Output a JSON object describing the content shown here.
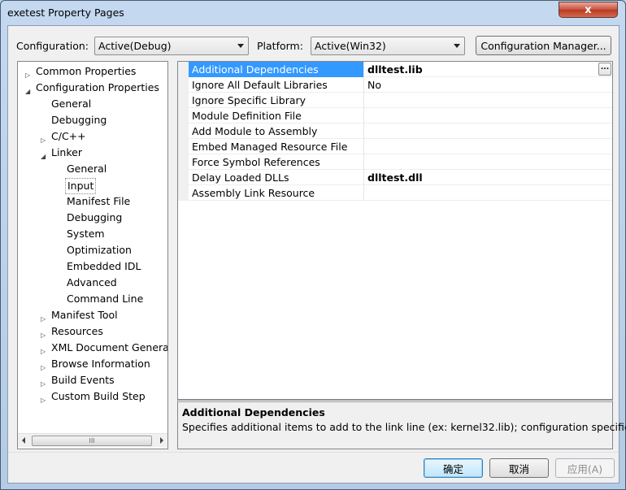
{
  "window": {
    "title": "exetest Property Pages",
    "close_glyph": "x"
  },
  "top_bar": {
    "configuration_label": "Configuration:",
    "configuration_value": "Active(Debug)",
    "platform_label": "Platform:",
    "platform_value": "Active(Win32)",
    "config_manager_label": "Configuration Manager..."
  },
  "tree": {
    "items": [
      {
        "label": "Common Properties",
        "expander": "▷"
      },
      {
        "label": "Configuration Properties",
        "expander": "◢"
      },
      {
        "label": "General",
        "expander": ""
      },
      {
        "label": "Debugging",
        "expander": ""
      },
      {
        "label": "C/C++",
        "expander": "▷"
      },
      {
        "label": "Linker",
        "expander": "◢"
      },
      {
        "label": "General",
        "expander": ""
      },
      {
        "label": "Input",
        "expander": ""
      },
      {
        "label": "Manifest File",
        "expander": ""
      },
      {
        "label": "Debugging",
        "expander": ""
      },
      {
        "label": "System",
        "expander": ""
      },
      {
        "label": "Optimization",
        "expander": ""
      },
      {
        "label": "Embedded IDL",
        "expander": ""
      },
      {
        "label": "Advanced",
        "expander": ""
      },
      {
        "label": "Command Line",
        "expander": ""
      },
      {
        "label": "Manifest Tool",
        "expander": "▷"
      },
      {
        "label": "Resources",
        "expander": "▷"
      },
      {
        "label": "XML Document Generat",
        "expander": "▷"
      },
      {
        "label": "Browse Information",
        "expander": "▷"
      },
      {
        "label": "Build Events",
        "expander": "▷"
      },
      {
        "label": "Custom Build Step",
        "expander": "▷"
      }
    ],
    "scroll_thumb_grip": "III"
  },
  "properties": {
    "rows": [
      {
        "name": "Additional Dependencies",
        "value": "dlltest.lib",
        "ellipsis": "..."
      },
      {
        "name": "Ignore All Default Libraries",
        "value": "No"
      },
      {
        "name": "Ignore Specific Library",
        "value": ""
      },
      {
        "name": "Module Definition File",
        "value": ""
      },
      {
        "name": "Add Module to Assembly",
        "value": ""
      },
      {
        "name": "Embed Managed Resource File",
        "value": ""
      },
      {
        "name": "Force Symbol References",
        "value": ""
      },
      {
        "name": "Delay Loaded DLLs",
        "value": "dlltest.dll"
      },
      {
        "name": "Assembly Link Resource",
        "value": ""
      }
    ]
  },
  "description": {
    "title": "Additional Dependencies",
    "text": "Specifies additional items to add to the link line (ex: kernel32.lib); configuration specific."
  },
  "buttons": {
    "ok": "确定",
    "cancel": "取消",
    "apply": "应用(A)"
  },
  "colors": {
    "selection": "#3399ff",
    "window_frame": "#b9d1ea"
  }
}
